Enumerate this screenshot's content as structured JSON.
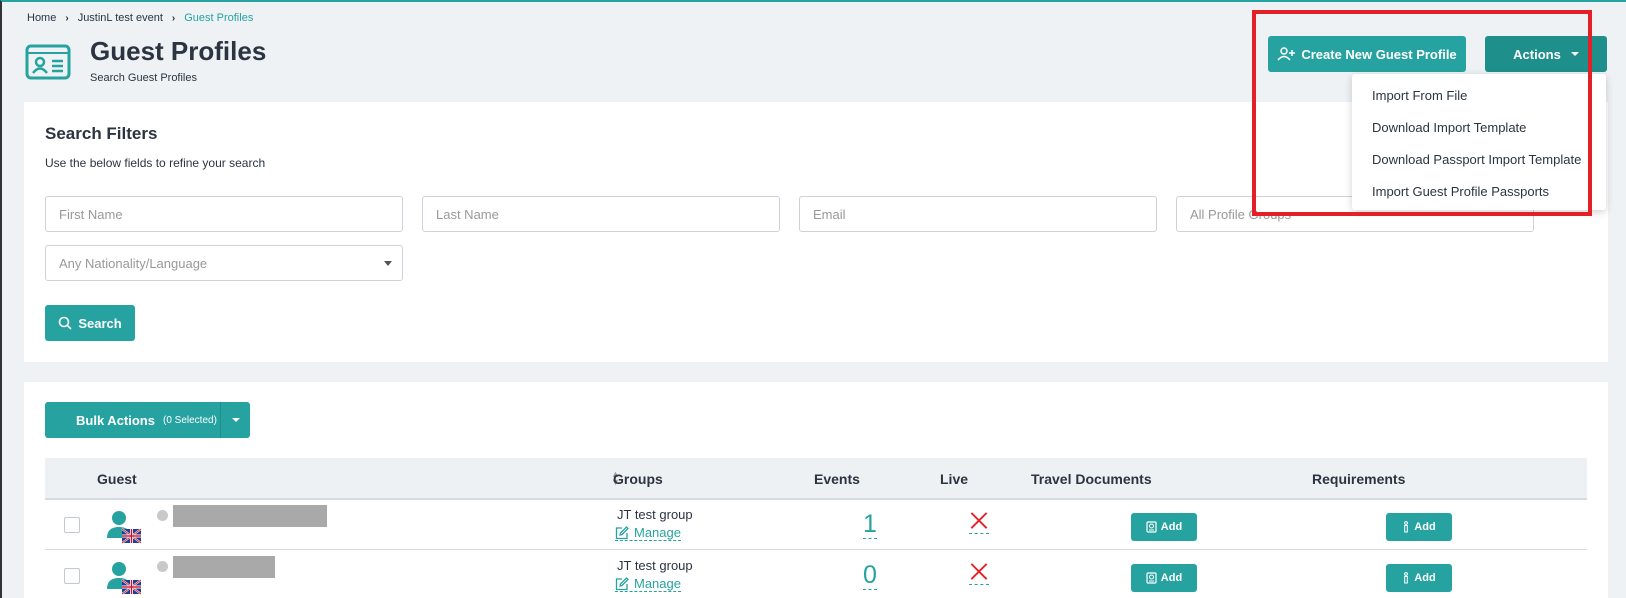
{
  "breadcrumb": {
    "home": "Home",
    "event": "JustinL test event",
    "current": "Guest Profiles"
  },
  "header": {
    "title": "Guest Profiles",
    "subtitle": "Search Guest Profiles"
  },
  "buttons": {
    "create": "Create New Guest Profile",
    "actions": "Actions"
  },
  "actions_menu": [
    "Import From File",
    "Download Import Template",
    "Download Passport Import Template",
    "Import Guest Profile Passports"
  ],
  "filters": {
    "title": "Search Filters",
    "description": "Use the below fields to refine your search",
    "first_name_placeholder": "First Name",
    "last_name_placeholder": "Last Name",
    "email_placeholder": "Email",
    "groups_placeholder": "All Profile Groups",
    "nationality_placeholder": "Any Nationality/Language",
    "search_label": "Search"
  },
  "bulk": {
    "label": "Bulk Actions",
    "selected": "(0 Selected)"
  },
  "table": {
    "columns": {
      "guest": "Guest",
      "groups": "Groups",
      "events": "Events",
      "live": "Live",
      "travel": "Travel Documents",
      "requirements": "Requirements"
    },
    "rows": [
      {
        "group": "JT test group",
        "manage": "Manage",
        "events": "1",
        "travel_add": "Add",
        "req_add": "Add"
      },
      {
        "group": "JT test group",
        "manage": "Manage",
        "events": "0",
        "travel_add": "Add",
        "req_add": "Add"
      }
    ]
  },
  "colors": {
    "accent": "#26a3a0",
    "highlight": "#e32028",
    "live_no": "#e32028"
  }
}
